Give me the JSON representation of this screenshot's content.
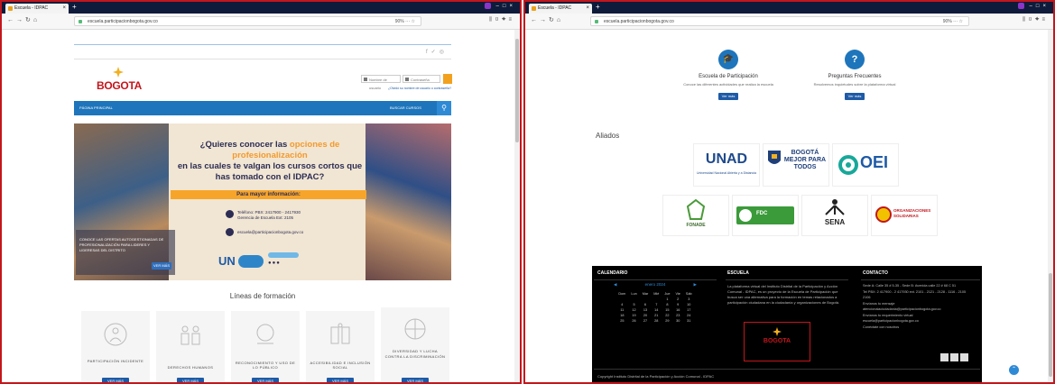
{
  "browser": {
    "left": {
      "tab_title": "Escuela - IDPAC",
      "url": "escuela.participacionbogota.gov.co",
      "zoom": "90%"
    },
    "right": {
      "tab_title": "Escuela - IDPAC",
      "url": "escuela.participacionbogota.gov.co",
      "zoom": "90%"
    }
  },
  "left_page": {
    "logo": "BOGOTA",
    "login": {
      "username_placeholder": "Nombre de usuario",
      "password_placeholder": "Contraseña",
      "forgot_link": "¿Olvidó su nombre de usuario o contraseña?"
    },
    "nav": {
      "home": "PÁGINA PRINCIPAL",
      "search": "BUSCAR CURSOS"
    },
    "banner": {
      "headline_1": "¿Quieres conocer las",
      "headline_highlight": "opciones de profesionalización",
      "headline_2": "en las cuales te valgan los cursos cortos que",
      "headline_3": "has tomado con el IDPAC?",
      "info_bar": "Para mayor información:",
      "phone_1": "Teléfono: PBX: 2417900 - 2417930",
      "phone_2": "Gerencia de Escuela Ext: 2105",
      "email": "escuela@participacionbogota.gov.co",
      "overlay_text": "CONOCE LAS OFERTAS AUTOGESTIONADAS DE PROFESIONALIZACIÓN PARA LIDERES Y LIDERESAS DEL DISTRITO",
      "overlay_button": "VER MÁS"
    },
    "lines_title": "Líneas de formación",
    "cards": [
      {
        "label": "PARTICIPACIÓN INCIDENTE",
        "button": "VER MÁS"
      },
      {
        "label": "DERECHOS HUMANOS",
        "button": "VER MÁS"
      },
      {
        "label": "RECONOCIMIENTO Y USO DE LO PÚBLICO",
        "button": "VER MÁS"
      },
      {
        "label": "ACCESIBILIDAD E INCLUSIÓN SOCIAL",
        "button": "VER MÁS"
      },
      {
        "label": "DIVERSIDAD Y LUCHA CONTRA LA DISCRIMINACIÓN",
        "button": "VER MÁS"
      }
    ]
  },
  "right_page": {
    "features": [
      {
        "title": "Escuela de Participación",
        "desc": "Conoce las diferentes actividades que realiza la escuela",
        "button": "Ver más"
      },
      {
        "title": "Preguntas Frecuentes",
        "desc": "Resolvemos inquietudes sobre la plataforma virtual",
        "button": "Ver más"
      }
    ],
    "allies_title": "Aliados",
    "allies": [
      {
        "name": "UNAD"
      },
      {
        "name": "BOGOTÁ MEJOR PARA TODOS"
      },
      {
        "name": "OEI"
      },
      {
        "name": "FONADE"
      },
      {
        "name": "FDC"
      },
      {
        "name": "SENA"
      },
      {
        "name": "ORGANIZACIONES SOLIDARIAS"
      }
    ],
    "footer": {
      "calendar_title": "CALENDARIO",
      "month": "enero 2024",
      "weekdays": [
        "Dom",
        "Lun",
        "Mar",
        "Mié",
        "Jue",
        "Vie",
        "Sáb"
      ],
      "weeks": [
        [
          "",
          "",
          "",
          "",
          "",
          "",
          ""
        ],
        [
          "",
          "",
          "",
          "",
          "1",
          "2",
          "3"
        ],
        [
          "4",
          "5",
          "6",
          "7",
          "8",
          "9",
          "10"
        ],
        [
          "11",
          "12",
          "13",
          "14",
          "15",
          "16",
          "17"
        ],
        [
          "18",
          "19",
          "20",
          "21",
          "22",
          "23",
          "24"
        ],
        [
          "25",
          "26",
          "27",
          "28",
          "29",
          "30",
          "31"
        ]
      ],
      "school_title": "ESCUELA",
      "school_text": "La plataforma virtual del Instituto Distrital de la Participación y Acción Comunal - IDPAC, es un proyecto de la Escuela de Participación que busca ser una alternativa para la formación en temas relacionados a participación ciudadana en la ciudadanía y organizaciones de Bogotá.",
      "school_logo": "BOGOTA",
      "contact_title": "CONTACTO",
      "contact_lines": [
        "Sede A: Calle 35 # 5-35 - Sede B: Avenida calle 22 # 68 C 51",
        "Tel PBX: 2 417900 - 2 417930 ext. 2101 - 2121 - 2128 - 1116 - 2105",
        "2106",
        "Envíanos tu mensaje",
        "atencionalaciudadania@participacionbogota.gov.co",
        "Envíanos tu requerimiento virtual",
        "escuela@participacionbogota.gov.co",
        "Conéctate con nosotros"
      ],
      "copyright": "Copyright Instituto Distrital de la Participación y Acción Comunal - IDPAC"
    }
  }
}
